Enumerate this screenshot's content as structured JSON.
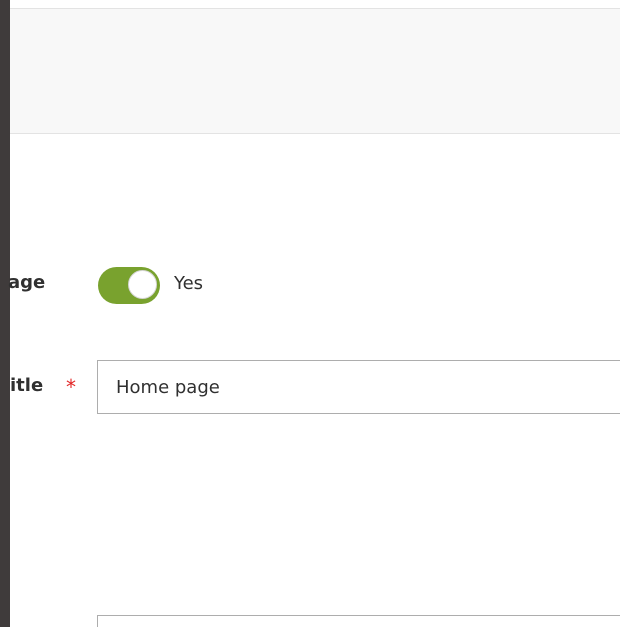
{
  "form": {
    "enable_field": {
      "label": "age",
      "toggle_state": "on",
      "toggle_text": "Yes"
    },
    "title_field": {
      "label": "itle",
      "required_mark": "*",
      "value": "Home page"
    }
  },
  "colors": {
    "toggle_on": "#79a22e",
    "required": "#e22626",
    "rail": "#3f3b3b"
  }
}
